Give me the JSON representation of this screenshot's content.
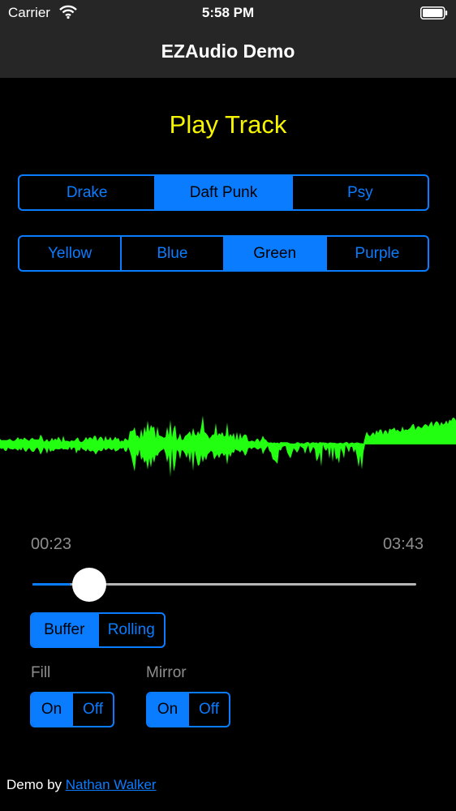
{
  "status_bar": {
    "carrier": "Carrier",
    "time": "5:58 PM"
  },
  "nav": {
    "title": "EZAudio Demo"
  },
  "play_button": {
    "label": "Play Track",
    "color": "#f5f500"
  },
  "track_selector": {
    "options": [
      "Drake",
      "Daft Punk",
      "Psy"
    ],
    "selected": "Daft Punk"
  },
  "color_selector": {
    "options": [
      "Yellow",
      "Blue",
      "Green",
      "Purple"
    ],
    "selected": "Green"
  },
  "waveform": {
    "color": "#22ff11"
  },
  "playback": {
    "elapsed": "00:23",
    "total": "03:43",
    "progress": 0.1
  },
  "plot_type": {
    "options": [
      "Buffer",
      "Rolling"
    ],
    "selected": "Buffer"
  },
  "fill": {
    "label": "Fill",
    "options": [
      "On",
      "Off"
    ],
    "selected": "On"
  },
  "mirror": {
    "label": "Mirror",
    "options": [
      "On",
      "Off"
    ],
    "selected": "On"
  },
  "footer": {
    "prefix": "Demo by",
    "author": "Nathan Walker"
  },
  "colors": {
    "accent": "#0a7cff",
    "background": "#000000",
    "bar": "#262626",
    "muted": "#8e8e8e"
  }
}
